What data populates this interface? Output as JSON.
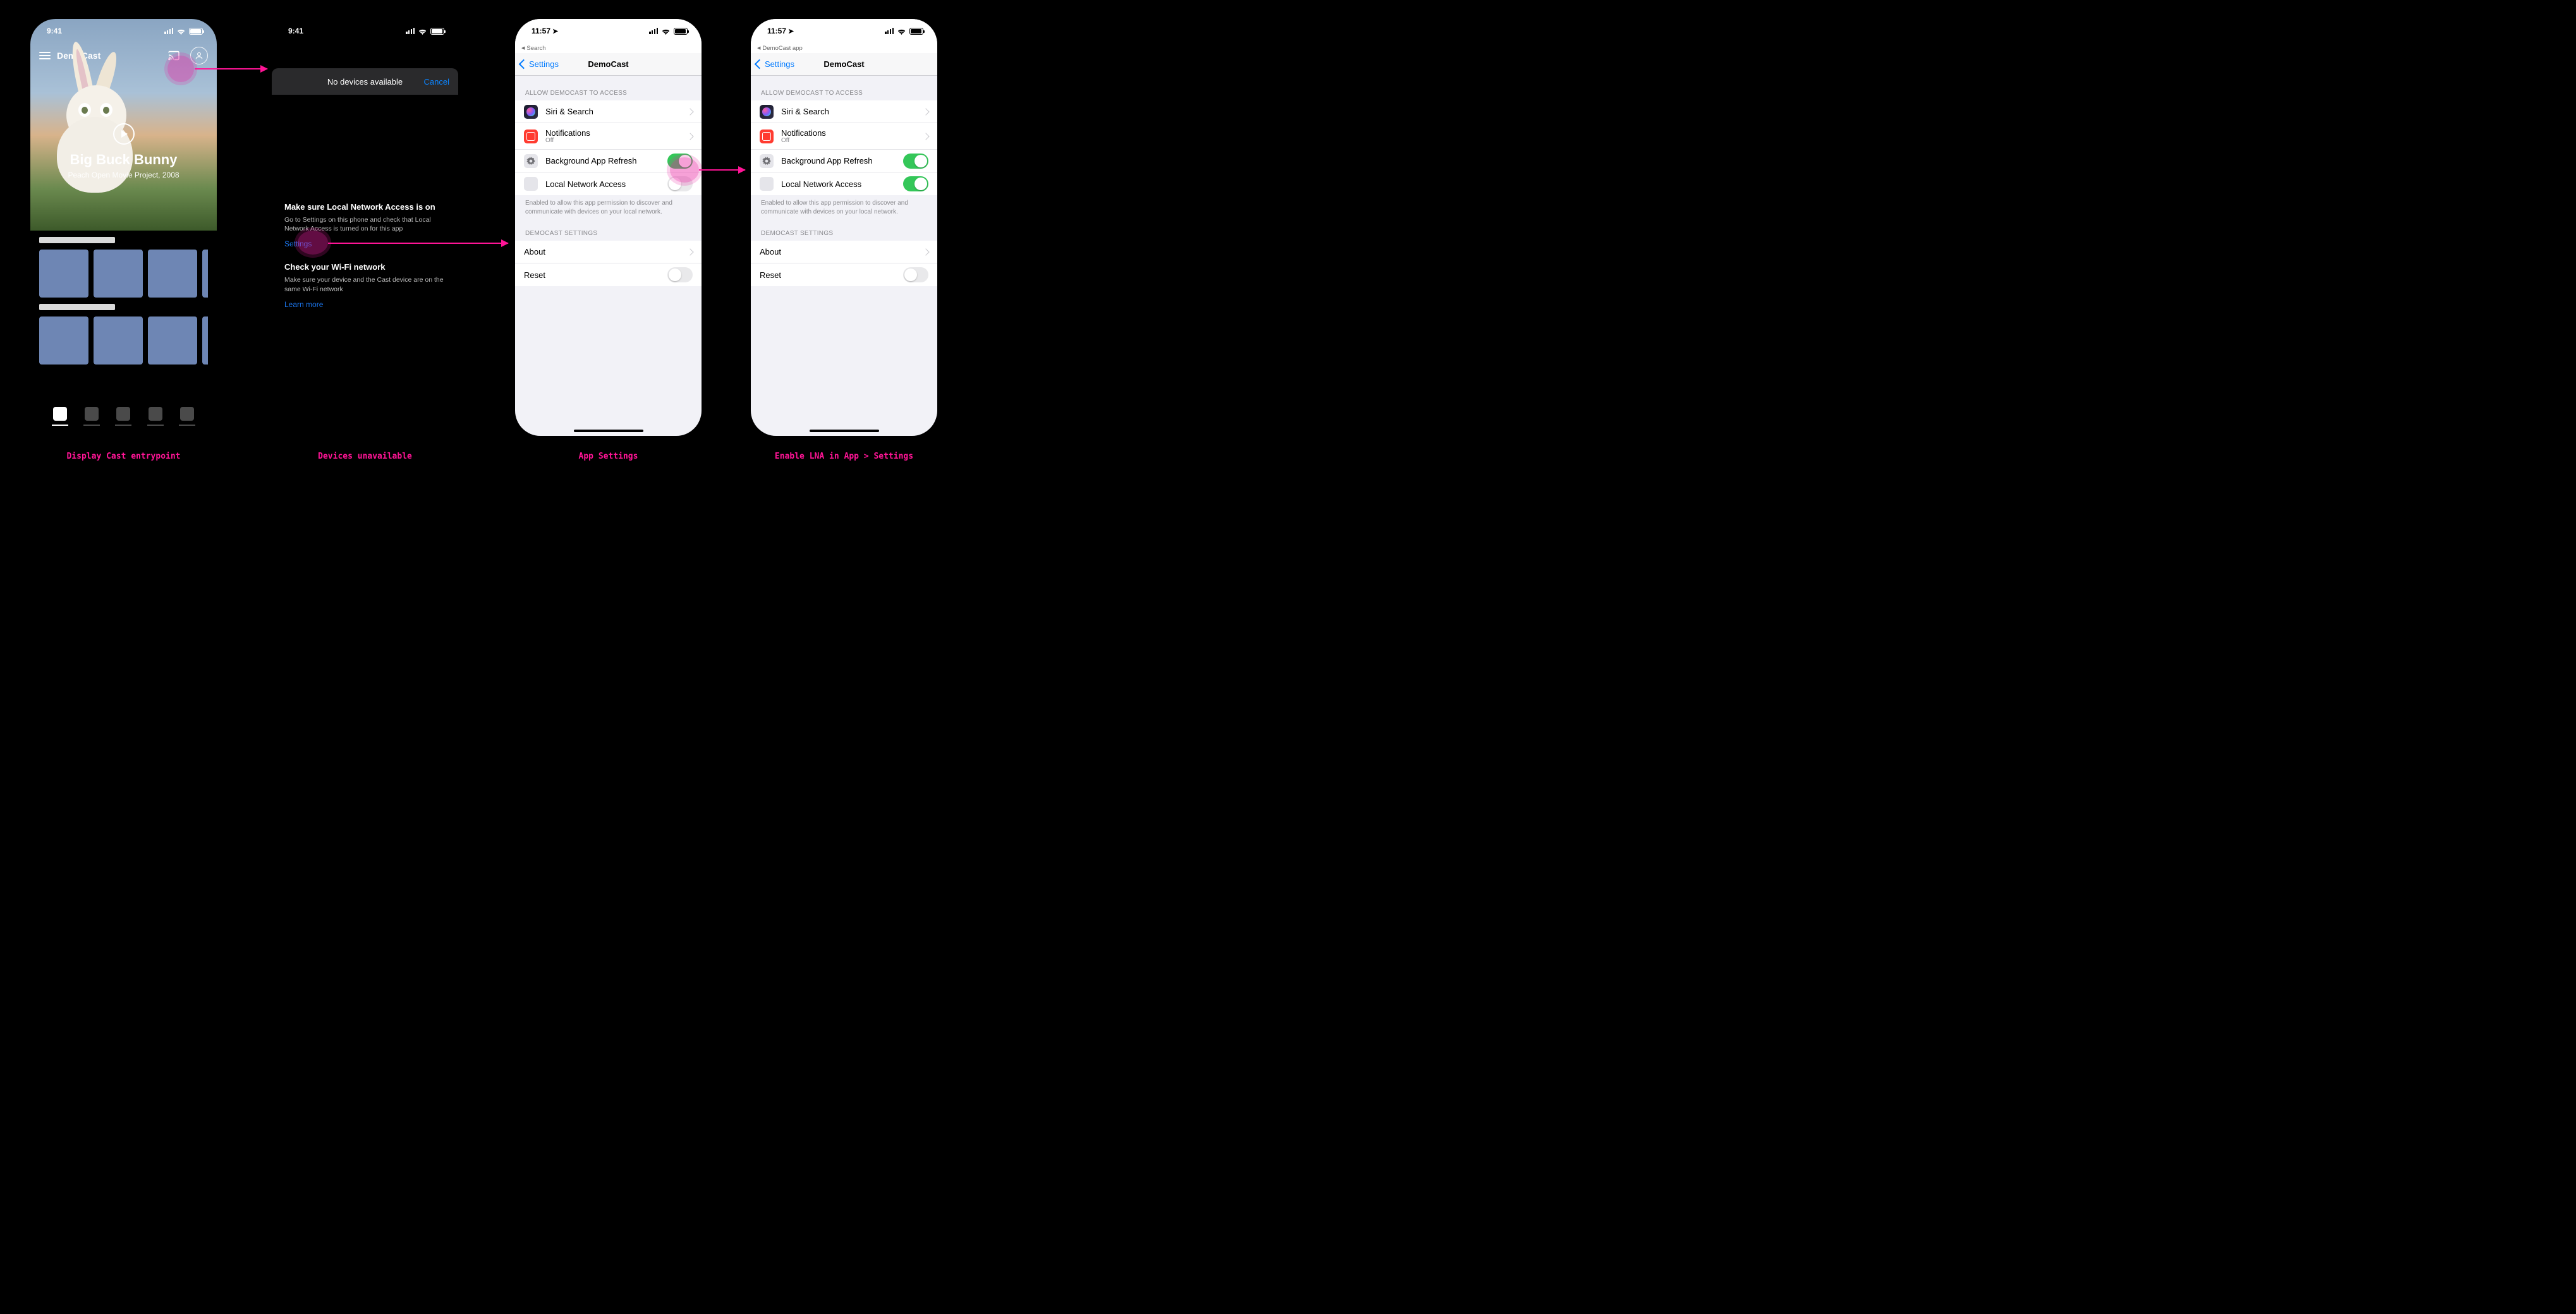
{
  "status_time_app": "9:41",
  "status_time_ios": "11:57",
  "p1": {
    "app_name": "DemoCast",
    "hero_title": "Big Buck Bunny",
    "hero_subtitle": "Peach Open Movie Project, 2008"
  },
  "p2": {
    "sheet_title": "No devices available",
    "cancel": "Cancel",
    "s1_title": "Make sure Local Network Access is on",
    "s1_desc": "Go to Settings on this phone and check that Local Network Access is turned on for this app",
    "s1_link": "Settings",
    "s2_title": "Check your Wi-Fi network",
    "s2_desc": "Make sure your device and the Cast device are on the same Wi-Fi network",
    "s2_link": "Learn more"
  },
  "ios": {
    "breadcrumb_p3": "Search",
    "breadcrumb_p4": "DemoCast app",
    "back_label": "Settings",
    "nav_title": "DemoCast",
    "group_access": "ALLOW DEMOCAST TO ACCESS",
    "row_siri": "Siri & Search",
    "row_notif": "Notifications",
    "row_notif_sub": "Off",
    "row_bgrefresh": "Background App Refresh",
    "row_lna": "Local Network Access",
    "lna_footer": "Enabled to allow this app permission to discover and communicate with devices on your local network.",
    "group_app": "DEMOCAST SETTINGS",
    "row_about": "About",
    "row_reset": "Reset"
  },
  "captions": {
    "c1": "Display Cast entrypoint",
    "c2": "Devices unavailable",
    "c3": "App Settings",
    "c4": "Enable LNA in App > Settings"
  }
}
